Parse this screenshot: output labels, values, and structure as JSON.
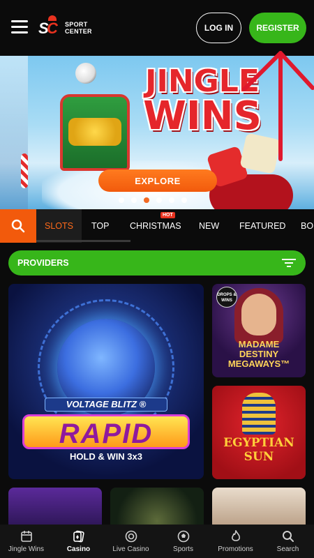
{
  "header": {
    "logo_text_line1": "SPORT",
    "logo_text_line2": "CENTER",
    "login_label": "LOG IN",
    "register_label": "REGISTER"
  },
  "banner": {
    "title_line1": "JINGLE",
    "title_line2": "WINS",
    "explore_label": "EXPLORE",
    "slide_count": 6,
    "active_slide": 3
  },
  "tabs": {
    "items": [
      {
        "label": "SLOTS",
        "active": true
      },
      {
        "label": "TOP",
        "active": false
      },
      {
        "label": "CHRISTMAS",
        "active": false,
        "badge": "HOT"
      },
      {
        "label": "NEW",
        "active": false
      },
      {
        "label": "FEATURED",
        "active": false
      },
      {
        "label": "BO",
        "active": false
      }
    ]
  },
  "providers": {
    "label": "PROVIDERS"
  },
  "games": {
    "rapid": {
      "line1": "VOLTAGE BLITZ ®",
      "line2": "RAPID",
      "line3": "HOLD & WIN 3x3"
    },
    "madame": {
      "badge": "DROPS & WINS",
      "line1": "MADAME",
      "line2": "DESTINY",
      "line3": "MEGAWAYS™"
    },
    "egypt": {
      "line1": "EGYPTIAN",
      "line2": "SUN"
    }
  },
  "bottom_nav": {
    "items": [
      {
        "label": "Jingle Wins",
        "icon": "calendar-icon"
      },
      {
        "label": "Casino",
        "icon": "cards-icon",
        "active": true
      },
      {
        "label": "Live Casino",
        "icon": "chip-icon"
      },
      {
        "label": "Sports",
        "icon": "soccer-ball-icon"
      },
      {
        "label": "Promotions",
        "icon": "flame-icon"
      },
      {
        "label": "Search",
        "icon": "search-icon"
      }
    ]
  },
  "colors": {
    "accent_orange": "#f25a0c",
    "accent_green": "#37b61a",
    "annotation_red": "#e0192d"
  }
}
